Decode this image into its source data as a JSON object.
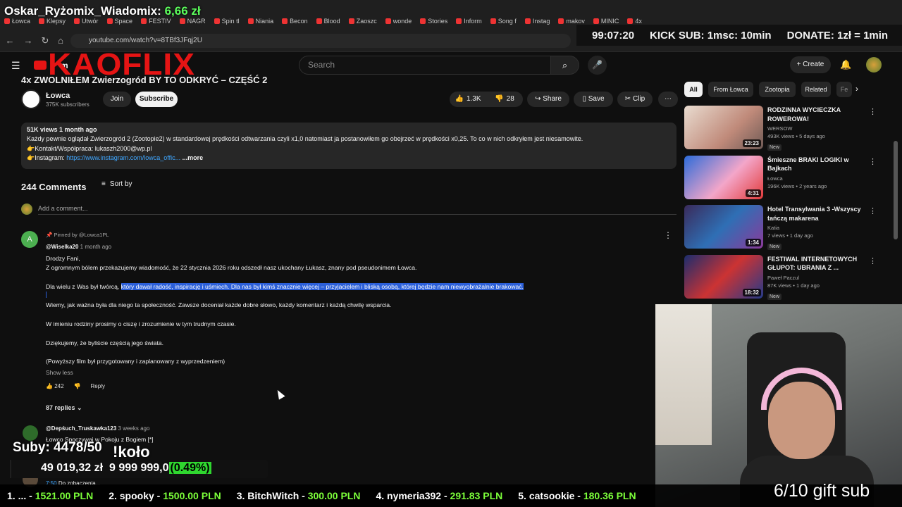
{
  "stream": {
    "title_prefix": "Oskar_Ryżomix_Wiadomix:",
    "title_amount": "6,66 zł",
    "timer": "99:07:20",
    "kick_sub": "KICK SUB: 1msc: 10min",
    "donate": "DONATE: 1zł = 1min",
    "logo": "KAOFLIX",
    "suby": "Suby: 4478/50",
    "kolo": "!koło",
    "money": "49 019,32 zł",
    "goal": "9 999 999,0",
    "pct": "(0.49%)",
    "progress_fraction": 0.0049,
    "gift": "6/10 gift sub",
    "leaderboard": [
      {
        "name": "1. ...",
        "amount": "1521.00 PLN"
      },
      {
        "name": "2. spooky",
        "amount": "1500.00 PLN"
      },
      {
        "name": "3. BitchWitch",
        "amount": "300.00 PLN"
      },
      {
        "name": "4. nymeria392",
        "amount": "291.83 PLN"
      },
      {
        "name": "5. catsookie",
        "amount": "180.36 PLN"
      }
    ]
  },
  "browser": {
    "tabs": [
      "Łowca",
      "Klepsy",
      "Utwór",
      "Space",
      "FESTIV",
      "NAGR",
      "Spin tl",
      "Niania",
      "Becon",
      "Blood",
      "Zaoszc",
      "wonde",
      "Stories",
      "Inform",
      "Song f",
      "Instag",
      "makov",
      "MINIC",
      "4x"
    ],
    "url": "youtube.com/watch?v=8TBf3JFqj2U"
  },
  "header": {
    "search_placeholder": "Search",
    "create": "Create",
    "logo_text": "m"
  },
  "video": {
    "title": "4x ZWOLNIŁEM Zwierzogród BY TO ODKRYĆ – CZĘŚĆ 2",
    "channel": "Łowca",
    "subs": "375K subscribers",
    "join": "Join",
    "subscribe": "Subscribe",
    "likes": "1.3K",
    "dislikes": "28",
    "share": "Share",
    "save": "Save",
    "clip": "Clip"
  },
  "description": {
    "meta": "51K views  1 month ago",
    "line1": "Każdy pewnie oglądał Zwierzogród 2 (Zootopie2)  w standardowej prędkości odtwarzania czyli x1,0 natomiast ja postanowiłem go obejrzeć w prędkości x0,25.  To co w nich odkryłem jest niesamowite.",
    "line2": "👉Kontakt/Współpraca:  lukaszh2000@wp.pl",
    "line3_prefix": "👉Instagram: ",
    "line3_link": "https://www.instagram.com/lowca_offic...",
    "more": "...more"
  },
  "comments": {
    "count": "244 Comments",
    "sort": "Sort by",
    "add": "Add a comment...",
    "pinned": {
      "avatar": "A",
      "pinned_by": "Pinned by @Lowca1PL",
      "author": "@Wiselka20",
      "time": "1 month ago",
      "lines": [
        "Drodzy Fani,",
        "Z ogromnym bólem przekazujemy wiadomość, że 22 stycznia 2026 roku odszedł nasz ukochany Łukasz, znany pod pseudonimem Łowca."
      ],
      "l3_plain": "Dla wielu z Was był twórcą, ",
      "l3_highlight": "który dawał radość, inspirację i uśmiech. Dla nas był kimś znacznie więcej – przyjacielem i bliską osobą, której będzie nam niewyobrażalnie brakować.",
      "l4": "Wiemy, jak ważna była dla niego ta społeczność. Zawsze doceniał każde dobre słowo, każdy komentarz i każdą chwilę wsparcia.",
      "l5": "W imieniu rodziny prosimy o ciszę i zrozumienie w tym trudnym czasie.",
      "l6": "Dziękujemy, że byliście częścią jego świata.",
      "l7": "(Powyższy film był przygotowany i zaplanowany  z wyprzedzeniem)",
      "show_less": "Show less",
      "likes": "242",
      "reply": "Reply",
      "replies": "87 replies"
    },
    "second": {
      "author": "@Depśuch_Truskawka123",
      "time": "3 weeks ago",
      "text": "Łowco Spoczywaj w Pokoju z Bogiem [*]"
    },
    "third": {
      "time": "7:50",
      "text": "Do zobaczenia..."
    }
  },
  "sidebar": {
    "chips": [
      "All",
      "From Łowca",
      "Zootopia",
      "Related",
      "Fe"
    ],
    "recs": [
      {
        "title": "RODZINNA WYCIECZKA ROWEROWA!",
        "channel": "WERSOW",
        "views": "493K views • 5 days ago",
        "badge": "New",
        "duration": "23:23"
      },
      {
        "title": "Śmieszne BRAKI LOGIKI w Bajkach",
        "channel": "Łowca",
        "views": "196K views • 2 years ago",
        "badge": "",
        "duration": "4:31"
      },
      {
        "title": "Hotel Transylwania 3 -Wszyscy tańczą makarena",
        "channel": "Katia",
        "views": "7 views • 1 day ago",
        "badge": "New",
        "duration": "1:34"
      },
      {
        "title": "FESTIWAL INTERNETOWYCH GŁUPOT: UBRANIA Z ...",
        "channel": "Paweł Paczul",
        "views": "87K views • 1 day ago",
        "badge": "New",
        "duration": "18:32"
      }
    ]
  },
  "colors": {
    "accent_red": "#e51414",
    "money_green": "#7cff3a",
    "highlight": "#2b5fd9"
  }
}
